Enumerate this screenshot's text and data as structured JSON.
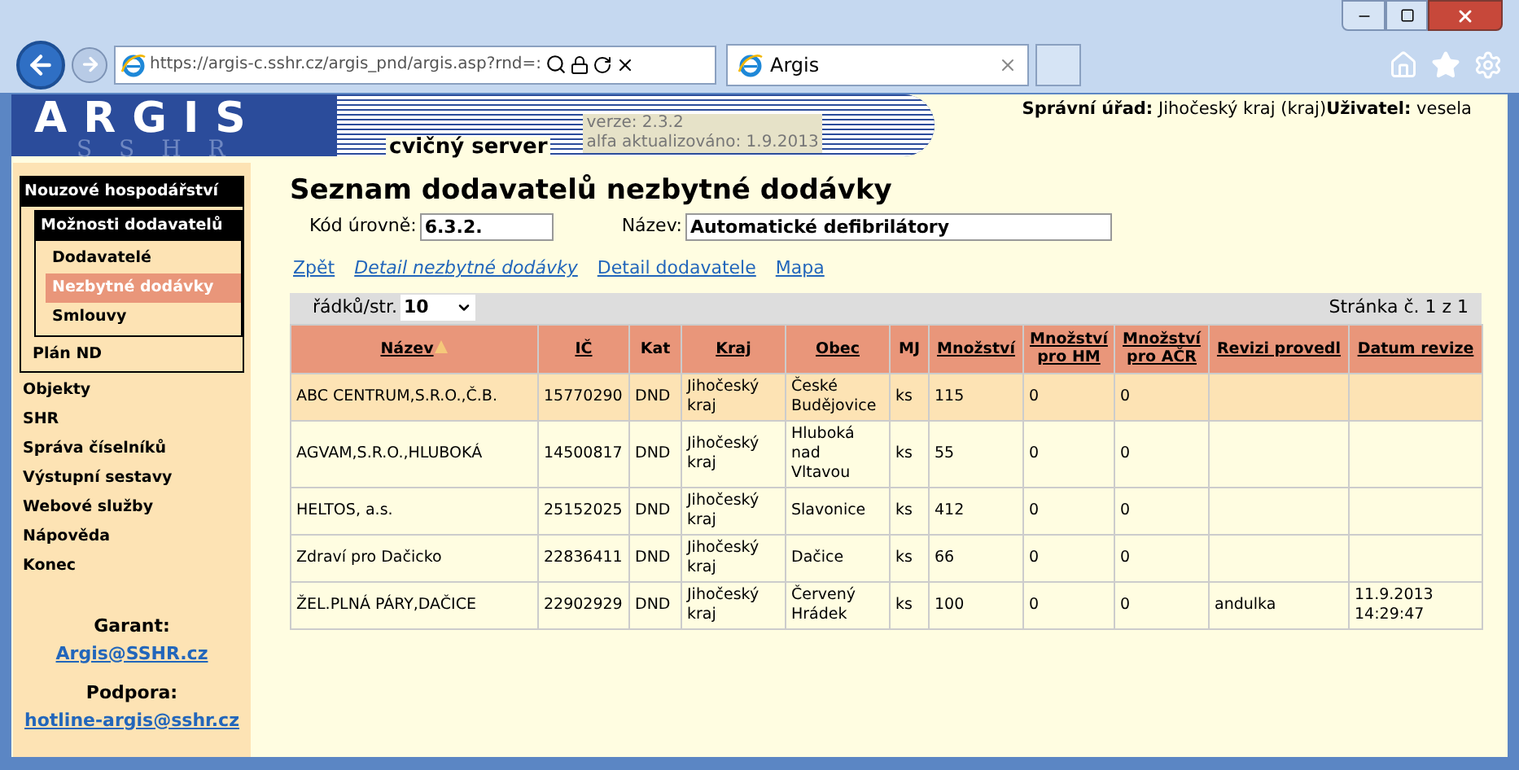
{
  "browser": {
    "address": "https://argis-c.sshr.cz/argis_pnd/argis.asp?rnd=:",
    "tab": "Argis"
  },
  "header": {
    "logo": "ARGIS",
    "logo_background": "S S H R",
    "subtitle": "cvičný server",
    "version": "verze: 2.3.2",
    "updated": "alfa aktualizováno: 1.9.2013",
    "office_label": "Správní úřad:",
    "office": "Jihočeský kraj (kraj)",
    "user_label": "Uživatel:",
    "user": "vesela"
  },
  "sidebar": {
    "items": [
      {
        "label": "Nouzové hospodářství",
        "selected": false,
        "expanded": true,
        "children": [
          {
            "label": "Možnosti dodavatelů",
            "selected": false,
            "expanded": true,
            "children": [
              {
                "label": "Dodavatelé",
                "selected": false
              },
              {
                "label": "Nezbytné dodávky",
                "selected": true
              },
              {
                "label": "Smlouvy",
                "selected": false
              }
            ]
          },
          {
            "label": "Plán ND",
            "selected": false
          }
        ]
      },
      {
        "label": "Objekty",
        "selected": false
      },
      {
        "label": "SHR",
        "selected": false
      },
      {
        "label": "Správa číselníků",
        "selected": false
      },
      {
        "label": "Výstupní sestavy",
        "selected": false
      },
      {
        "label": "Webové služby",
        "selected": false
      },
      {
        "label": "Nápověda",
        "selected": false
      },
      {
        "label": "Konec",
        "selected": false
      }
    ],
    "contacts": [
      {
        "label": "Garant:",
        "email": "Argis@SSHR.cz"
      },
      {
        "label": "Podpora:",
        "email": "hotline-argis@sshr.cz"
      }
    ]
  },
  "main": {
    "title": "Seznam dodavatelů nezbytné dodávky",
    "fields": [
      {
        "label": "Kód úrovně:",
        "value": "6.3.2."
      },
      {
        "label": "Název:",
        "value": "Automatické defibrilátory"
      }
    ],
    "links": [
      {
        "label": "Zpět",
        "emphasized": false
      },
      {
        "label": "Detail nezbytné dodávky",
        "emphasized": true
      },
      {
        "label": "Detail dodavatele",
        "emphasized": false
      },
      {
        "label": "Mapa",
        "emphasized": false
      }
    ],
    "pager": {
      "rows_label": "řádků/str.",
      "rows_value": "10",
      "page_text": "Stránka č. 1 z 1"
    },
    "table": {
      "columns": [
        {
          "label": "Název",
          "link": true,
          "sorted": true
        },
        {
          "label": "IČ",
          "link": true,
          "sorted": false
        },
        {
          "label": "Kat",
          "link": false,
          "sorted": false
        },
        {
          "label": "Kraj",
          "link": true,
          "sorted": false
        },
        {
          "label": "Obec",
          "link": true,
          "sorted": false
        },
        {
          "label": "MJ",
          "link": false,
          "sorted": false
        },
        {
          "label": "Množství",
          "link": true,
          "sorted": false
        },
        {
          "label": "Množství pro HM",
          "link": true,
          "sorted": false
        },
        {
          "label": "Množství pro AČR",
          "link": true,
          "sorted": false
        },
        {
          "label": "Revizi provedl",
          "link": true,
          "sorted": false
        },
        {
          "label": "Datum revize",
          "link": true,
          "sorted": false
        }
      ],
      "rows": [
        {
          "selected": true,
          "cells": [
            "ABC CENTRUM,S.R.O.,Č.B.",
            "15770290",
            "DND",
            "Jihočeský kraj",
            "České Budějovice",
            "ks",
            "115",
            "0",
            "0",
            "",
            ""
          ]
        },
        {
          "selected": false,
          "cells": [
            "AGVAM,S.R.O.,HLUBOKÁ",
            "14500817",
            "DND",
            "Jihočeský kraj",
            "Hluboká nad Vltavou",
            "ks",
            "55",
            "0",
            "0",
            "",
            ""
          ]
        },
        {
          "selected": false,
          "cells": [
            "HELTOS, a.s.",
            "25152025",
            "DND",
            "Jihočeský kraj",
            "Slavonice",
            "ks",
            "412",
            "0",
            "0",
            "",
            ""
          ]
        },
        {
          "selected": false,
          "cells": [
            "Zdraví pro Dačicko",
            "22836411",
            "DND",
            "Jihočeský kraj",
            "Dačice",
            "ks",
            "66",
            "0",
            "0",
            "",
            ""
          ]
        },
        {
          "selected": false,
          "cells": [
            "ŽEL.PLNÁ PÁRY,DAČICE",
            "22902929",
            "DND",
            "Jihočeský kraj",
            "Červený Hrádek",
            "ks",
            "100",
            "0",
            "0",
            "andulka",
            "11.9.2013 14:29:47"
          ]
        }
      ]
    }
  }
}
